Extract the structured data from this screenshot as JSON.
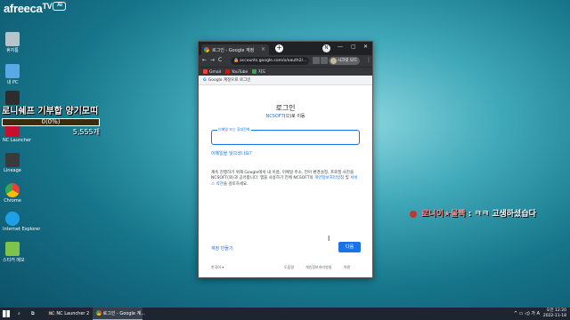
{
  "watermark": {
    "brand": "afreeca",
    "tv": "TV",
    "badge": "AI"
  },
  "desktop_icons": [
    {
      "name": "recycle-bin-icon",
      "label": "휴지통",
      "color": "#b8c4cc"
    },
    {
      "name": "pc-icon",
      "label": "내 PC",
      "color": "#5aa9e6"
    },
    {
      "name": "ncsoft-icon",
      "label": "NC Launcher 2",
      "color": "#2d2d2d"
    },
    {
      "name": "app-icon",
      "label": "NC Launcher",
      "color": "#c8102e"
    },
    {
      "name": "game-icon",
      "label": "Lineage",
      "color": "#3a3a3a"
    },
    {
      "name": "chrome-icon",
      "label": "Chrome",
      "color": "#fbbc05"
    },
    {
      "name": "ie-icon",
      "label": "Internet Explorer",
      "color": "#1ea0e6"
    },
    {
      "name": "note-icon",
      "label": "스티커 메모",
      "color": "#7fc34a"
    }
  ],
  "overlay": {
    "title": "로니쉐프 기부합 양기모띠",
    "progress_text": "0(0%)",
    "progress_fraction": 0,
    "count": "5,555개"
  },
  "chat": {
    "nick": "로니이★물빡",
    "sep": ":",
    "message": "ㅋㅋ 고생하셨습다"
  },
  "browser": {
    "tab_title": "로그인 - Google 계정",
    "tab_close": "×",
    "new_tab": "+",
    "account_avatar": "N",
    "window_controls": [
      "—",
      "▢",
      "✕"
    ],
    "nav": [
      "←",
      "→",
      "C",
      "⌂"
    ],
    "url": "accounts.google.com/o/oauth2/...",
    "profile_name": "시크릿 모드",
    "menu": "⋮",
    "bookmarks": [
      {
        "label": "Gmail",
        "color": "#ea4335"
      },
      {
        "label": "YouTube",
        "color": "#ff0000"
      },
      {
        "label": "지도",
        "color": "#34a853"
      }
    ],
    "page_header_g": "G",
    "page_header": "Google 계정으로 로그인"
  },
  "login": {
    "title": "로그인",
    "subtitle_brand": "NCSOFT",
    "subtitle_rest": "(으)로 이동",
    "email_placeholder": "이메일 또는 휴대전화",
    "forgot": "이메일을 잊으셨나요?",
    "notice": "계속 진행하기 위해 Google에서 내 이름, 이메일 주소, 언어 환경설정, 프로필 사진을 NCSOFT(와)과 공유합니다. 앱을 사용하기 전에 NCSOFT의",
    "privacy_link": "개인정보처리방침",
    "notice_and": "및",
    "terms_link": "서비스 약관",
    "notice_end": "을 검토하세요.",
    "create_account": "계정 만들기",
    "next_button": "다음"
  },
  "footer": {
    "language": "한국어 ▾",
    "help": "도움말",
    "privacy": "개인정보처리방침",
    "terms": "약관"
  },
  "taskbar": {
    "items": [
      {
        "label": "NC Launcher 2"
      },
      {
        "label": "로그인 - Google 계..."
      }
    ],
    "tray": "^ ▭ ◁) 가 A",
    "time": "오전 12:20",
    "date": "2022-11-18"
  }
}
